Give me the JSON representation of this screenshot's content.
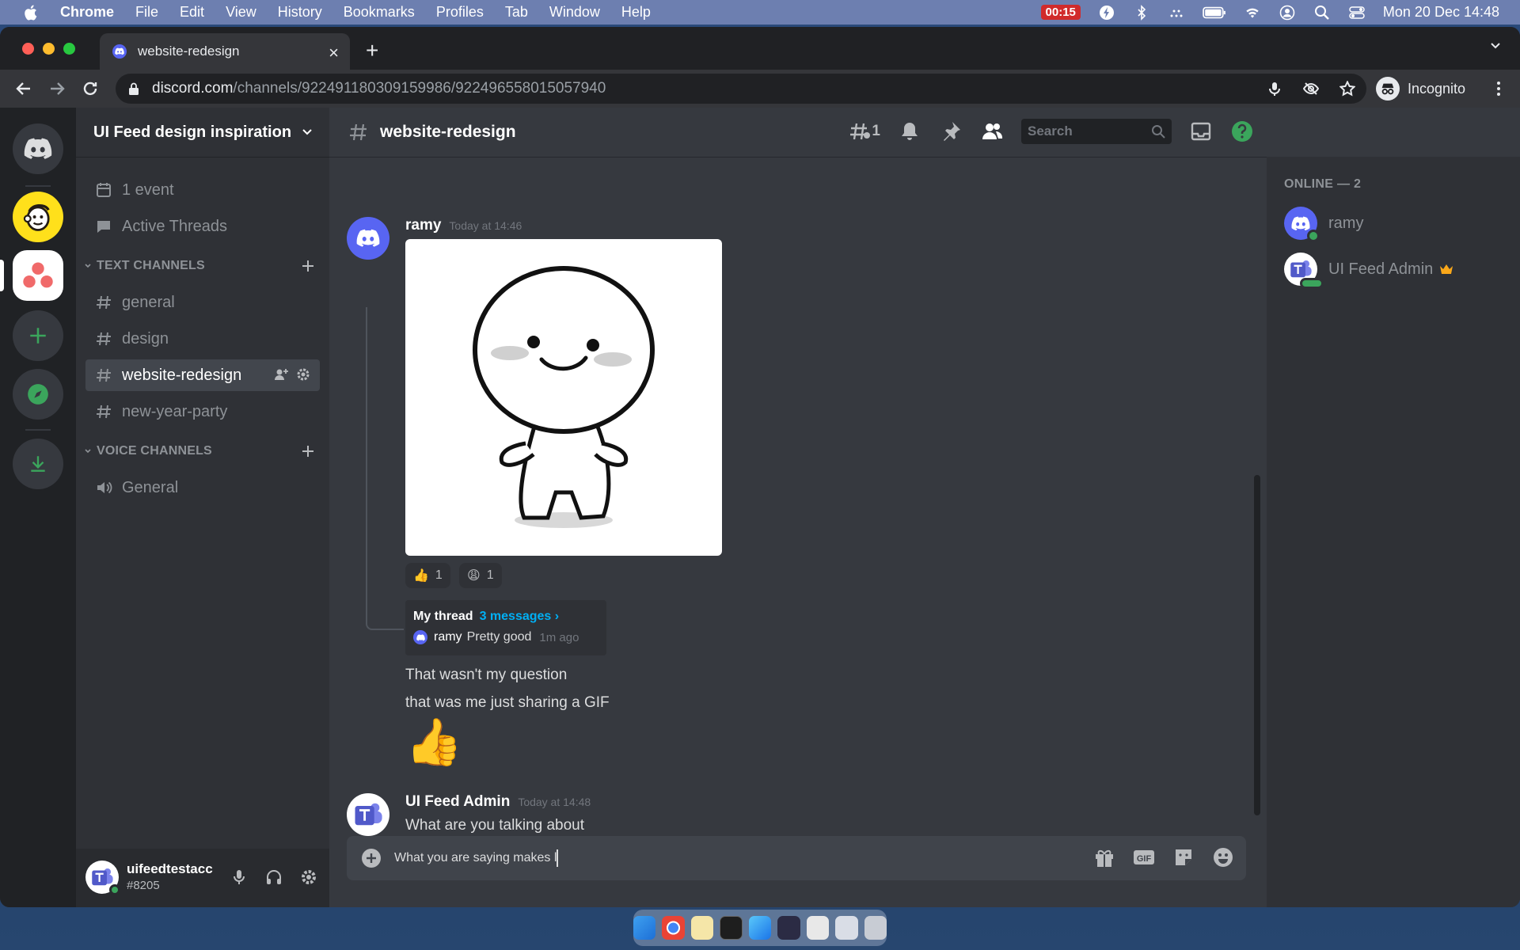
{
  "menubar": {
    "app": "Chrome",
    "items": [
      "File",
      "Edit",
      "View",
      "History",
      "Bookmarks",
      "Profiles",
      "Tab",
      "Window",
      "Help"
    ],
    "recording": "00:15",
    "datetime": "Mon 20 Dec  14:48"
  },
  "browser": {
    "tab_title": "website-redesign",
    "url_host": "discord.com",
    "url_path": "/channels/922491180309159986/922496558015057940",
    "profile_label": "Incognito"
  },
  "server": {
    "name": "UI Feed design inspiration",
    "events": "1 event",
    "active_threads": "Active Threads",
    "text_category": "TEXT CHANNELS",
    "text_channels": [
      "general",
      "design",
      "website-redesign",
      "new-year-party"
    ],
    "voice_category": "VOICE CHANNELS",
    "voice_channels": [
      "General"
    ]
  },
  "user": {
    "name": "uifeedtestacc",
    "tag": "#8205"
  },
  "channel": {
    "name": "website-redesign",
    "thread_count": "1",
    "search_placeholder": "Search"
  },
  "messages": [
    {
      "author": "ramy",
      "timestamp": "Today at 14:46",
      "reactions": [
        {
          "emoji": "👍",
          "count": "1"
        },
        {
          "emoji": "😩",
          "count": "1"
        }
      ],
      "thread": {
        "name": "My thread",
        "count": "3 messages ›",
        "last_author": "ramy",
        "last_text": "Pretty good",
        "last_time": "1m ago"
      },
      "lines": [
        "That wasn't my question",
        "that was me just sharing a GIF"
      ],
      "big_emoji": "👍"
    },
    {
      "author": "UI Feed Admin",
      "timestamp": "Today at 14:48",
      "lines": [
        "What are you talking about"
      ]
    }
  ],
  "composer": {
    "value": "What you are saying makes l"
  },
  "members": {
    "header": "ONLINE — 2",
    "list": [
      "ramy",
      "UI Feed Admin"
    ]
  },
  "colors": {
    "blurple": "#5865f2",
    "online": "#3ba55c",
    "link": "#00aff4",
    "crown": "#faa81a"
  }
}
